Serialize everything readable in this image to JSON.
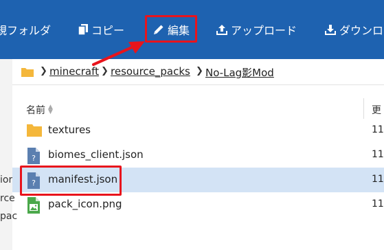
{
  "toolbar": {
    "new_folder_label": "規フォルダ",
    "copy_label": "コピー",
    "edit_label": "編集",
    "upload_label": "アップロード",
    "download_label": "ダウンロ"
  },
  "sidebar": {
    "fragments": [
      "ior",
      "rce",
      "pac"
    ]
  },
  "breadcrumb": {
    "items": [
      "minecraft",
      "resource_packs",
      "No-Lag影Mod"
    ]
  },
  "file_list": {
    "columns": {
      "name": "名前",
      "updated": "更"
    },
    "rows": [
      {
        "name": "textures",
        "type": "folder",
        "date": "11,"
      },
      {
        "name": "biomes_client.json",
        "type": "json",
        "date": "11,"
      },
      {
        "name": "manifest.json",
        "type": "json",
        "date": "11,",
        "selected": true
      },
      {
        "name": "pack_icon.png",
        "type": "image",
        "date": "11,"
      }
    ]
  },
  "colors": {
    "toolbar_bg": "#1e62b0",
    "highlight": "#e8141c",
    "selected_row": "#d3e3f5",
    "folder": "#f4b73b",
    "file_icon": "#5b7fb0",
    "image_icon": "#4aa84a"
  }
}
